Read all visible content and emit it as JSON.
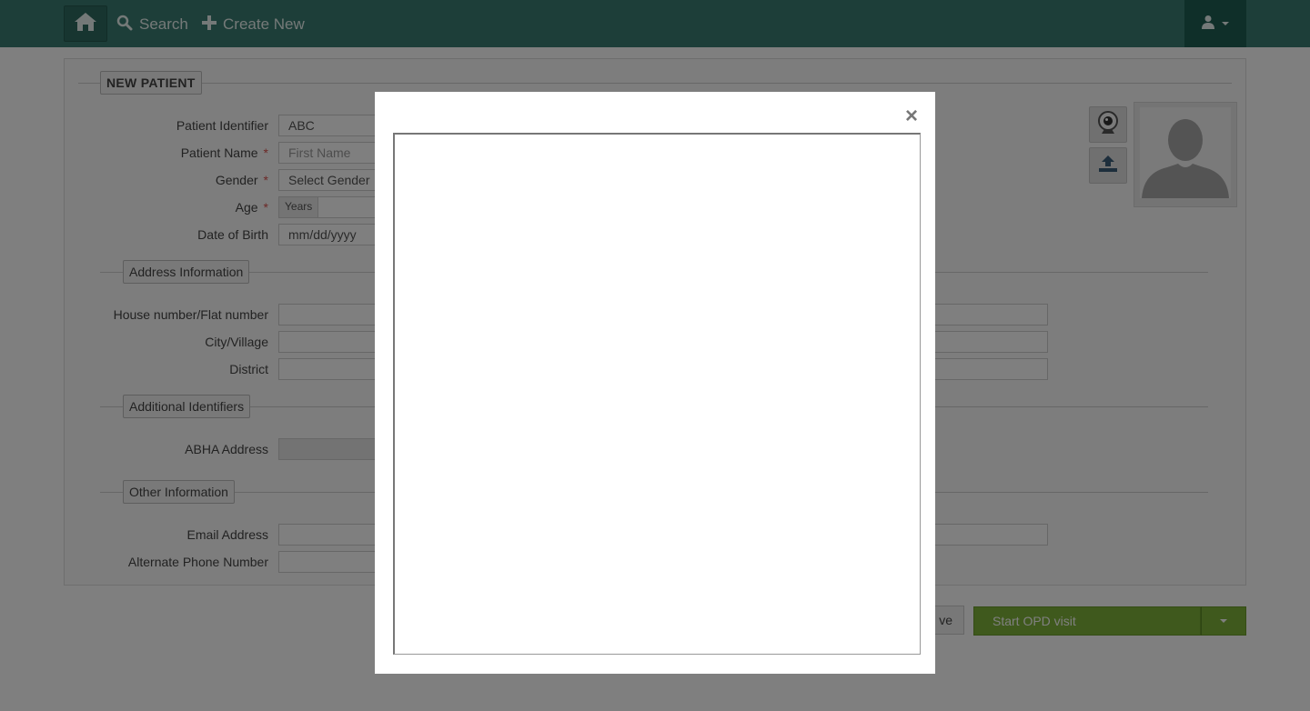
{
  "nav": {
    "search_label": "Search",
    "create_new_label": "Create New",
    "home_icon": "home-icon",
    "user_icon": "user-doctor-icon"
  },
  "form": {
    "section_title": "NEW PATIENT",
    "patient_identifier": {
      "label": "Patient Identifier",
      "value": "ABC"
    },
    "patient_name": {
      "label": "Patient Name",
      "placeholder": "First Name",
      "required_mark": "*"
    },
    "gender": {
      "label": "Gender",
      "value": "Select Gender",
      "required_mark": "*"
    },
    "age": {
      "label": "Age",
      "unit": "Years",
      "required_mark": "*"
    },
    "dob": {
      "label": "Date of Birth",
      "value": "mm/dd/yyyy"
    },
    "address_section": "Address Information",
    "house": {
      "label": "House number/Flat number"
    },
    "city": {
      "label": "City/Village"
    },
    "district": {
      "label": "District"
    },
    "identifiers_section": "Additional Identifiers",
    "abha": {
      "label": "ABHA Address"
    },
    "other_section": "Other Information",
    "email": {
      "label": "Email Address"
    },
    "alt_phone": {
      "label": "Alternate Phone Number"
    }
  },
  "actions": {
    "save_label": "ve",
    "start_opd_label": "Start OPD visit"
  },
  "modal": {
    "close_label": "×"
  },
  "colors": {
    "navbar": "#3a7d72",
    "opd_button": "#7fb33a",
    "required": "#d9534f"
  }
}
